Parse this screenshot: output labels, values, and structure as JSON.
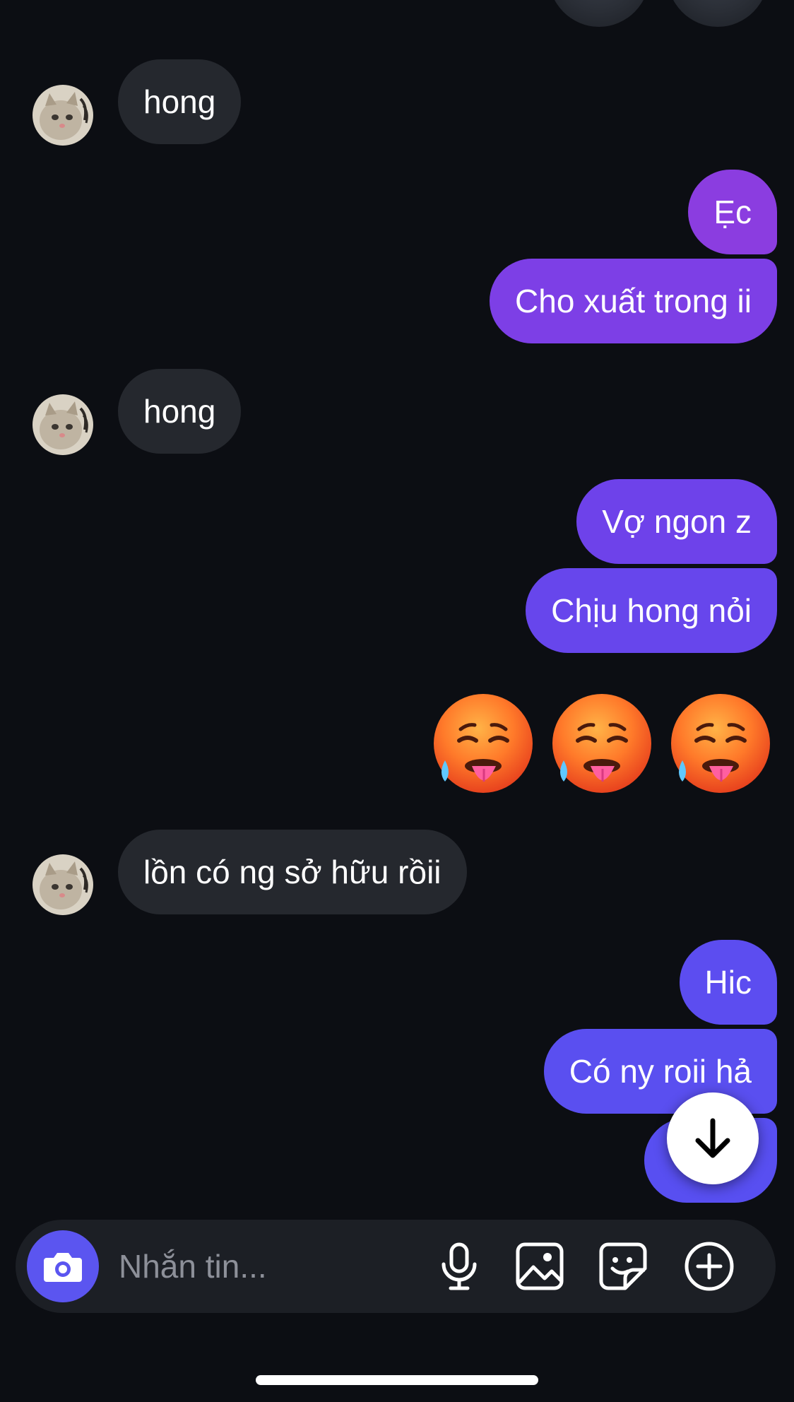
{
  "colors": {
    "background": "#0c0e13",
    "incoming_bubble": "#25282e",
    "outgoing_purple": "#8a3fe0",
    "outgoing_indigo": "#5b4ff0",
    "camera_button": "#5b55f0",
    "composer_bg": "#1c1f25",
    "placeholder": "#8d9099"
  },
  "conversation": {
    "messages": [
      {
        "side": "in",
        "text": "hong"
      },
      {
        "side": "out",
        "text": "Ẹc"
      },
      {
        "side": "out",
        "text": "Cho xuất trong ii"
      },
      {
        "side": "in",
        "text": "hong"
      },
      {
        "side": "out",
        "text": "Vợ ngon z"
      },
      {
        "side": "out",
        "text": "Chịu hong nỏi"
      },
      {
        "side": "out",
        "type": "emoji",
        "icon": "hot-face-emoji",
        "count": 3
      },
      {
        "side": "in",
        "text": "lồn có ng sở hữu rồii"
      },
      {
        "side": "out",
        "text": "Hic"
      },
      {
        "side": "out",
        "text": "Có ny roii hả"
      },
      {
        "side": "out",
        "text": "",
        "note": "partially hidden behind scroll button"
      }
    ],
    "contact_avatar_icon": "cat-avatar"
  },
  "composer": {
    "placeholder": "Nhắn tin...",
    "camera_icon": "camera-icon",
    "tools": [
      "microphone-icon",
      "image-icon",
      "sticker-icon",
      "add-circle-icon"
    ]
  },
  "scroll_button_icon": "arrow-down-icon"
}
